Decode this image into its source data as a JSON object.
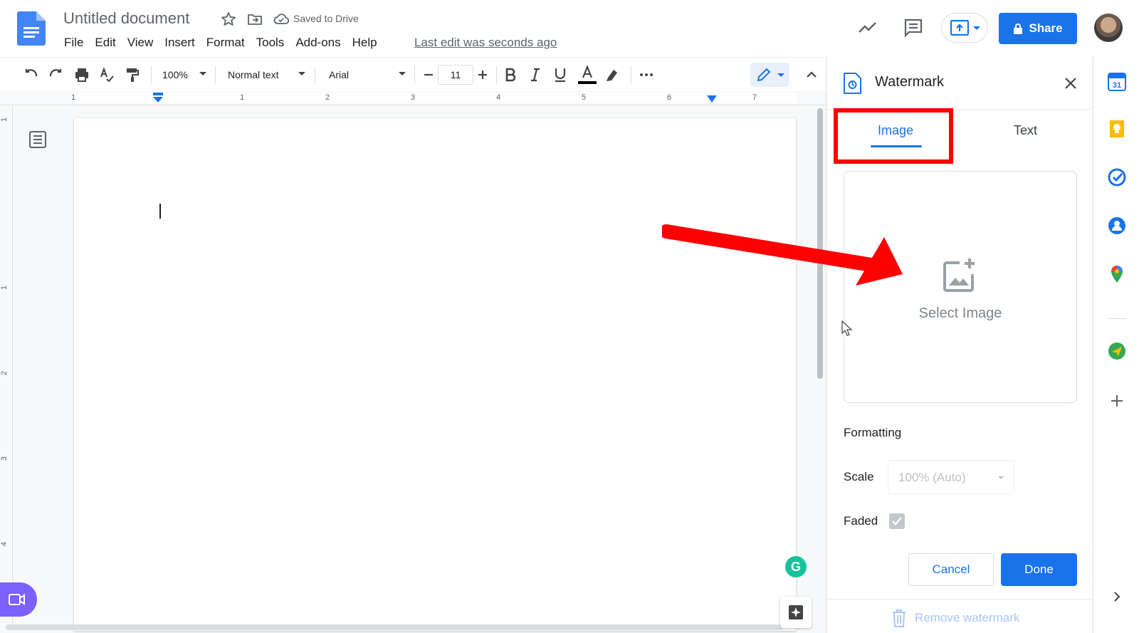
{
  "header": {
    "doc_title": "Untitled document",
    "saved_status": "Saved to Drive",
    "menu": [
      "File",
      "Edit",
      "View",
      "Insert",
      "Format",
      "Tools",
      "Add-ons",
      "Help"
    ],
    "last_edit": "Last edit was seconds ago",
    "share_label": "Share"
  },
  "toolbar": {
    "zoom": "100%",
    "style": "Normal text",
    "font": "Arial",
    "font_size": "11"
  },
  "ruler": {
    "numbers": [
      "1",
      "1",
      "2",
      "3",
      "4",
      "5",
      "6",
      "7"
    ],
    "vertical_numbers": [
      "1",
      "1",
      "2",
      "3",
      "4"
    ]
  },
  "panel": {
    "title": "Watermark",
    "tabs": {
      "image": "Image",
      "text": "Text"
    },
    "select_image": "Select Image",
    "formatting": "Formatting",
    "scale_label": "Scale",
    "scale_value": "100% (Auto)",
    "faded_label": "Faded",
    "faded_checked": true,
    "cancel": "Cancel",
    "done": "Done",
    "remove_watermark": "Remove watermark"
  },
  "grammarly_letter": "G",
  "colors": {
    "accent": "#1a73e8",
    "annotation": "#ff0000",
    "meet": "#7b61ff",
    "grammarly": "#15c39a"
  },
  "icons": {
    "header": [
      "docs-logo-icon",
      "star-icon",
      "move-folder-icon",
      "cloud-saved-icon",
      "activity-trend-icon",
      "comment-icon",
      "present-icon",
      "lock-icon"
    ],
    "toolbar": [
      "undo-icon",
      "redo-icon",
      "print-icon",
      "spellcheck-icon",
      "paint-format-icon",
      "bold-icon",
      "italic-icon",
      "underline-icon",
      "text-color-icon",
      "highlight-icon",
      "more-icon",
      "editing-mode-icon",
      "collapse-icon"
    ],
    "side": [
      "calendar-icon",
      "keep-icon",
      "tasks-icon",
      "contacts-icon",
      "maps-icon",
      "addon-icon",
      "add-icon",
      "expand-icon"
    ]
  }
}
